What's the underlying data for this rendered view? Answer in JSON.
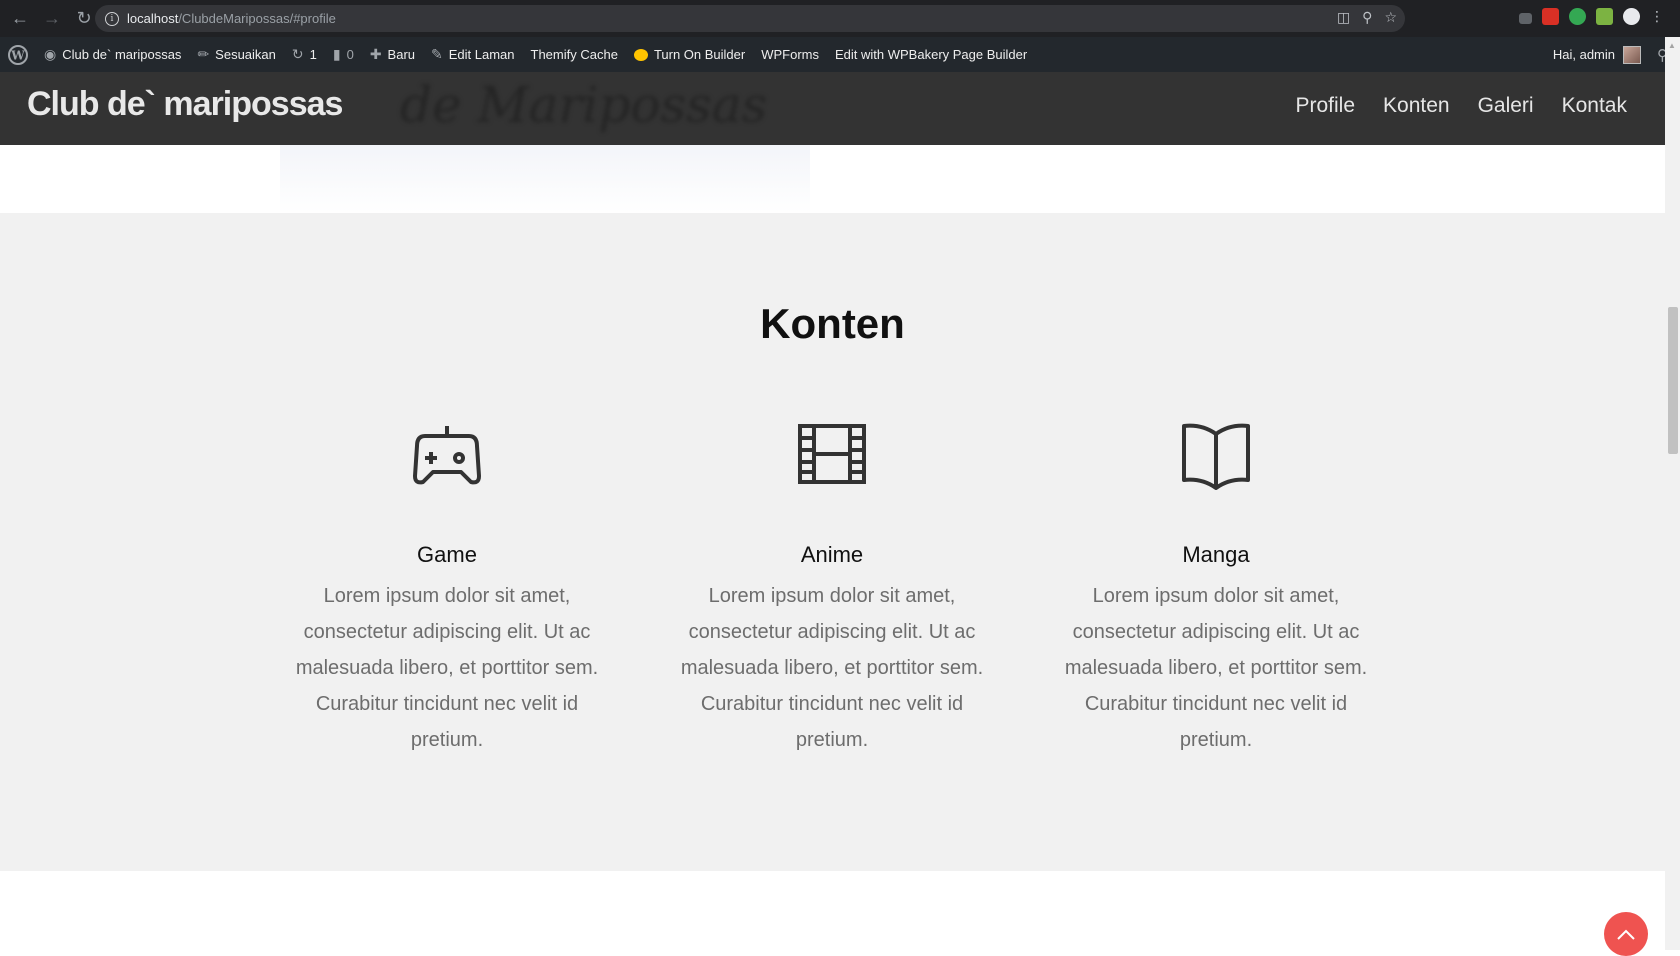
{
  "browser": {
    "url_host": "localhost",
    "url_path": "/ClubdeMaripossas/#profile"
  },
  "adminbar": {
    "site_name": "Club de` maripossas",
    "customize": "Sesuaikan",
    "updates_count": "1",
    "comments_count": "0",
    "new": "Baru",
    "edit_page": "Edit Laman",
    "themify_cache": "Themify Cache",
    "turn_on_builder": "Turn On Builder",
    "wpforms": "WPForms",
    "wpbakery": "Edit with WPBakery Page Builder",
    "greeting": "Hai, admin"
  },
  "site": {
    "title": "Club de` maripossas",
    "nav": [
      "Profile",
      "Konten",
      "Galeri",
      "Kontak"
    ]
  },
  "section": {
    "title": "Konten",
    "cards": [
      {
        "icon": "gamepad-icon",
        "title": "Game",
        "text": "Lorem ipsum dolor sit amet, consectetur adipiscing elit. Ut ac malesuada libero, et porttitor sem. Curabitur tincidunt nec velit id pretium."
      },
      {
        "icon": "film-icon",
        "title": "Anime",
        "text": "Lorem ipsum dolor sit amet, consectetur adipiscing elit. Ut ac malesuada libero, et porttitor sem. Curabitur tincidunt nec velit id pretium."
      },
      {
        "icon": "book-open-icon",
        "title": "Manga",
        "text": "Lorem ipsum dolor sit amet, consectetur adipiscing elit. Ut ac malesuada libero, et porttitor sem. Curabitur tincidunt nec velit id pretium."
      }
    ]
  },
  "colors": {
    "admin_bar": "#23282d",
    "header": "#333333",
    "section_bg": "#f1f1f1",
    "back_to_top": "#ef5350"
  }
}
